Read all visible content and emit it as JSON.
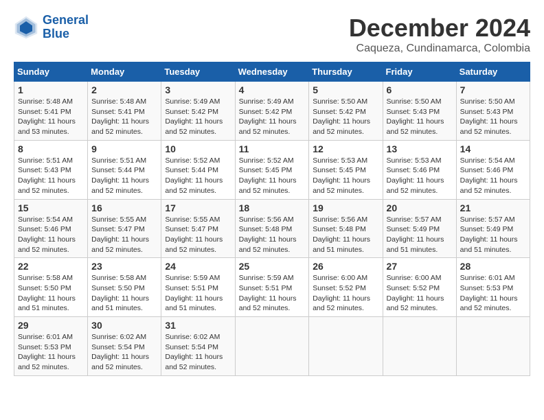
{
  "logo": {
    "line1": "General",
    "line2": "Blue"
  },
  "title": "December 2024",
  "location": "Caqueza, Cundinamarca, Colombia",
  "days_of_week": [
    "Sunday",
    "Monday",
    "Tuesday",
    "Wednesday",
    "Thursday",
    "Friday",
    "Saturday"
  ],
  "weeks": [
    [
      {
        "day": "1",
        "sunrise": "5:48 AM",
        "sunset": "5:41 PM",
        "daylight": "11 hours and 53 minutes."
      },
      {
        "day": "2",
        "sunrise": "5:48 AM",
        "sunset": "5:41 PM",
        "daylight": "11 hours and 52 minutes."
      },
      {
        "day": "3",
        "sunrise": "5:49 AM",
        "sunset": "5:42 PM",
        "daylight": "11 hours and 52 minutes."
      },
      {
        "day": "4",
        "sunrise": "5:49 AM",
        "sunset": "5:42 PM",
        "daylight": "11 hours and 52 minutes."
      },
      {
        "day": "5",
        "sunrise": "5:50 AM",
        "sunset": "5:42 PM",
        "daylight": "11 hours and 52 minutes."
      },
      {
        "day": "6",
        "sunrise": "5:50 AM",
        "sunset": "5:43 PM",
        "daylight": "11 hours and 52 minutes."
      },
      {
        "day": "7",
        "sunrise": "5:50 AM",
        "sunset": "5:43 PM",
        "daylight": "11 hours and 52 minutes."
      }
    ],
    [
      {
        "day": "8",
        "sunrise": "5:51 AM",
        "sunset": "5:43 PM",
        "daylight": "11 hours and 52 minutes."
      },
      {
        "day": "9",
        "sunrise": "5:51 AM",
        "sunset": "5:44 PM",
        "daylight": "11 hours and 52 minutes."
      },
      {
        "day": "10",
        "sunrise": "5:52 AM",
        "sunset": "5:44 PM",
        "daylight": "11 hours and 52 minutes."
      },
      {
        "day": "11",
        "sunrise": "5:52 AM",
        "sunset": "5:45 PM",
        "daylight": "11 hours and 52 minutes."
      },
      {
        "day": "12",
        "sunrise": "5:53 AM",
        "sunset": "5:45 PM",
        "daylight": "11 hours and 52 minutes."
      },
      {
        "day": "13",
        "sunrise": "5:53 AM",
        "sunset": "5:46 PM",
        "daylight": "11 hours and 52 minutes."
      },
      {
        "day": "14",
        "sunrise": "5:54 AM",
        "sunset": "5:46 PM",
        "daylight": "11 hours and 52 minutes."
      }
    ],
    [
      {
        "day": "15",
        "sunrise": "5:54 AM",
        "sunset": "5:46 PM",
        "daylight": "11 hours and 52 minutes."
      },
      {
        "day": "16",
        "sunrise": "5:55 AM",
        "sunset": "5:47 PM",
        "daylight": "11 hours and 52 minutes."
      },
      {
        "day": "17",
        "sunrise": "5:55 AM",
        "sunset": "5:47 PM",
        "daylight": "11 hours and 52 minutes."
      },
      {
        "day": "18",
        "sunrise": "5:56 AM",
        "sunset": "5:48 PM",
        "daylight": "11 hours and 52 minutes."
      },
      {
        "day": "19",
        "sunrise": "5:56 AM",
        "sunset": "5:48 PM",
        "daylight": "11 hours and 51 minutes."
      },
      {
        "day": "20",
        "sunrise": "5:57 AM",
        "sunset": "5:49 PM",
        "daylight": "11 hours and 51 minutes."
      },
      {
        "day": "21",
        "sunrise": "5:57 AM",
        "sunset": "5:49 PM",
        "daylight": "11 hours and 51 minutes."
      }
    ],
    [
      {
        "day": "22",
        "sunrise": "5:58 AM",
        "sunset": "5:50 PM",
        "daylight": "11 hours and 51 minutes."
      },
      {
        "day": "23",
        "sunrise": "5:58 AM",
        "sunset": "5:50 PM",
        "daylight": "11 hours and 51 minutes."
      },
      {
        "day": "24",
        "sunrise": "5:59 AM",
        "sunset": "5:51 PM",
        "daylight": "11 hours and 51 minutes."
      },
      {
        "day": "25",
        "sunrise": "5:59 AM",
        "sunset": "5:51 PM",
        "daylight": "11 hours and 52 minutes."
      },
      {
        "day": "26",
        "sunrise": "6:00 AM",
        "sunset": "5:52 PM",
        "daylight": "11 hours and 52 minutes."
      },
      {
        "day": "27",
        "sunrise": "6:00 AM",
        "sunset": "5:52 PM",
        "daylight": "11 hours and 52 minutes."
      },
      {
        "day": "28",
        "sunrise": "6:01 AM",
        "sunset": "5:53 PM",
        "daylight": "11 hours and 52 minutes."
      }
    ],
    [
      {
        "day": "29",
        "sunrise": "6:01 AM",
        "sunset": "5:53 PM",
        "daylight": "11 hours and 52 minutes."
      },
      {
        "day": "30",
        "sunrise": "6:02 AM",
        "sunset": "5:54 PM",
        "daylight": "11 hours and 52 minutes."
      },
      {
        "day": "31",
        "sunrise": "6:02 AM",
        "sunset": "5:54 PM",
        "daylight": "11 hours and 52 minutes."
      },
      null,
      null,
      null,
      null
    ]
  ]
}
